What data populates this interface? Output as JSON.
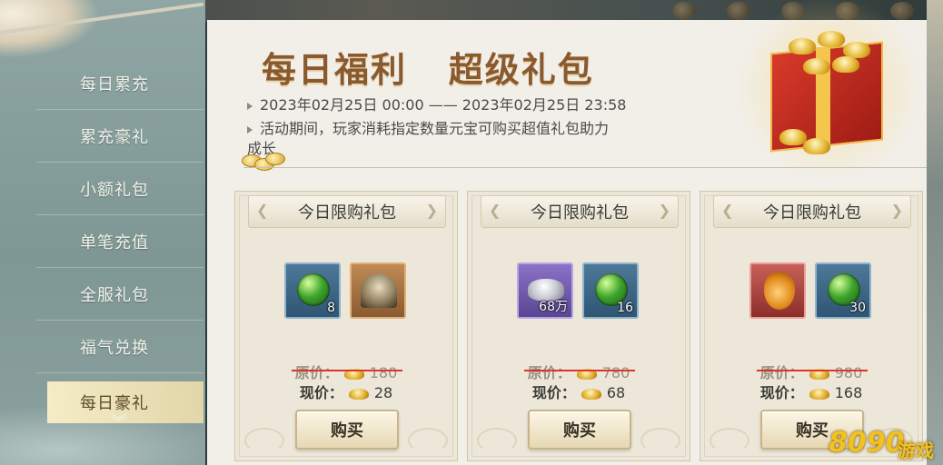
{
  "sidebar": {
    "items": [
      {
        "label": "每日累充"
      },
      {
        "label": "累充豪礼"
      },
      {
        "label": "小额礼包"
      },
      {
        "label": "单笔充值"
      },
      {
        "label": "全服礼包"
      },
      {
        "label": "福气兑换"
      },
      {
        "label": "每日豪礼"
      }
    ],
    "active_index": 6,
    "scroll_icon": "chevron-down-icon"
  },
  "header": {
    "title": "每日福利   超级礼包",
    "period": "2023年02月25日 00:00 —— 2023年02月25日 23:58",
    "description_line1": "活动期间，玩家消耗指定数量元宝可购买超值礼包助力",
    "description_line2": "成长"
  },
  "cards": [
    {
      "title": "今日限购礼包",
      "items": [
        {
          "icon": "green-orb-icon",
          "qty": "8",
          "frame": "blue"
        },
        {
          "icon": "sundial-icon",
          "qty": "",
          "frame": "orange"
        }
      ],
      "original_label": "原价：",
      "original_price": "180",
      "current_label": "现价：",
      "current_price": "28",
      "buy_label": "购买"
    },
    {
      "title": "今日限购礼包",
      "items": [
        {
          "icon": "silver-ingot-icon",
          "qty": "68万",
          "frame": "purple"
        },
        {
          "icon": "green-orb-icon",
          "qty": "16",
          "frame": "blue"
        }
      ],
      "original_label": "原价：",
      "original_price": "780",
      "current_label": "现价：",
      "current_price": "68",
      "buy_label": "购买"
    },
    {
      "title": "今日限购礼包",
      "items": [
        {
          "icon": "lucky-bag-icon",
          "qty": "",
          "frame": "red"
        },
        {
          "icon": "green-orb-icon",
          "qty": "30",
          "frame": "blue"
        }
      ],
      "original_label": "原价：",
      "original_price": "980",
      "current_label": "现价：",
      "current_price": "168",
      "buy_label": "购买"
    }
  ],
  "currency_icon": "gold-ingot-icon",
  "watermark": {
    "digits": "8090",
    "word": "游戏"
  },
  "colors": {
    "title": "#8a5a2e",
    "sidebar_bg": "#8fa6a4",
    "active_tab": "#f5e8c0",
    "strike": "#d9372b"
  }
}
